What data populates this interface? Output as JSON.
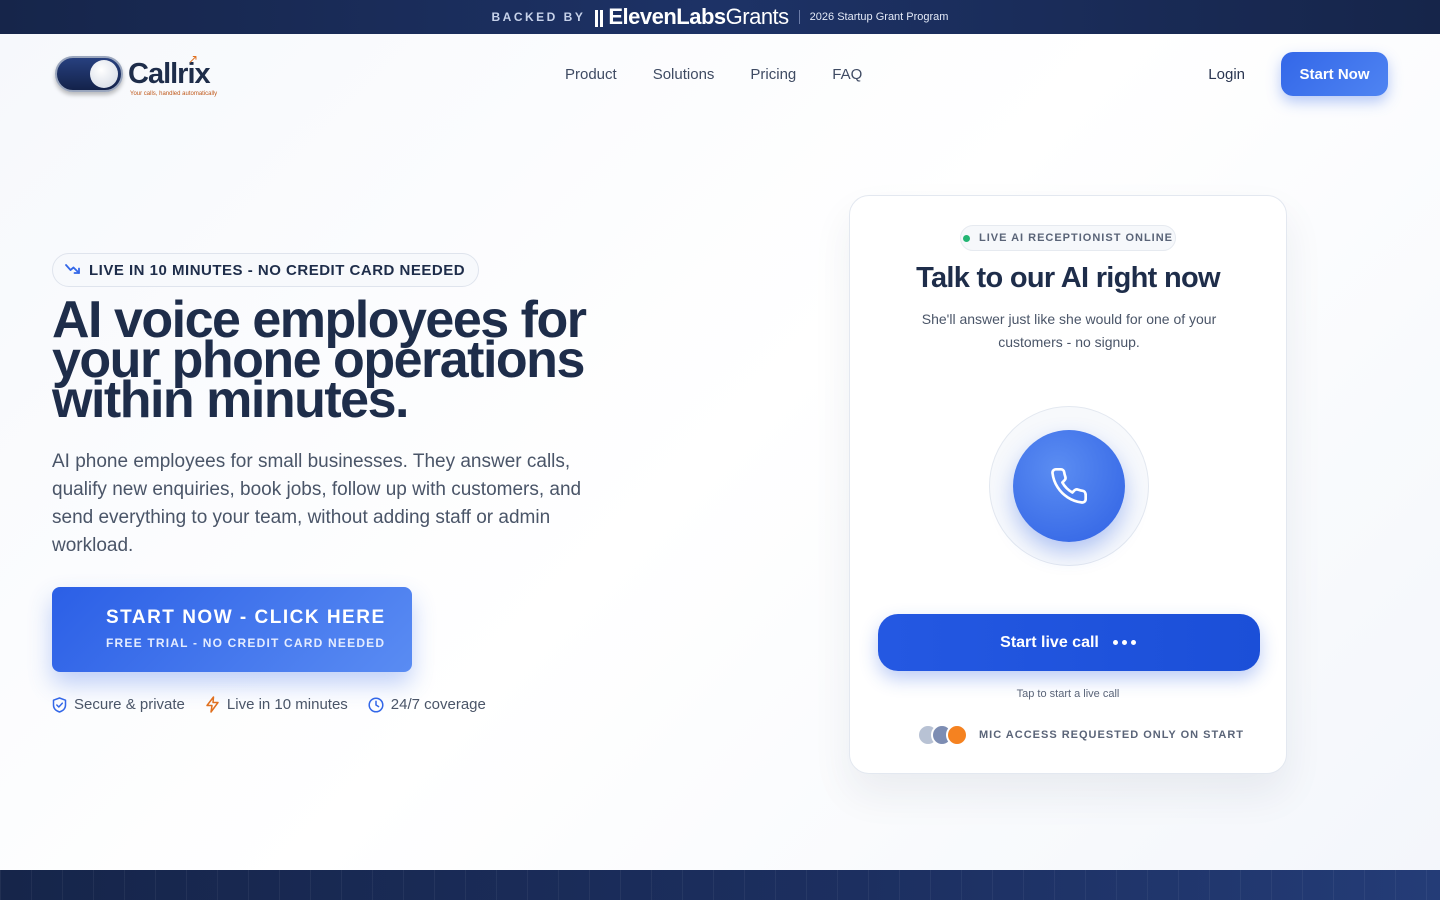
{
  "banner": {
    "backed_by": "BACKED BY",
    "brand_bold": "ElevenLabs",
    "brand_light": "Grants",
    "program": "2026 Startup Grant Program"
  },
  "nav": {
    "logo_name": "Callrix",
    "logo_tagline": "Your calls, handled automatically",
    "links": [
      "Product",
      "Solutions",
      "Pricing",
      "FAQ"
    ],
    "login": "Login",
    "start_now": "Start Now"
  },
  "hero": {
    "pill": "LIVE IN 10 MINUTES - NO CREDIT CARD NEEDED",
    "headline": [
      "AI voice employees for",
      "your phone operations",
      "within minutes."
    ],
    "subtext": "AI phone employees for small businesses. They answer calls, qualify new enquiries, book jobs, follow up with customers, and send everything to your team, without adding staff or admin workload.",
    "cta_main": "START NOW - CLICK HERE",
    "cta_sub": "FREE TRIAL - NO CREDIT CARD NEEDED",
    "trust": [
      "Secure & private",
      "Live in 10 minutes",
      "24/7 coverage"
    ]
  },
  "card": {
    "status": "LIVE AI RECEPTIONIST ONLINE",
    "title": "Talk to our AI right now",
    "subtitle": "She'll answer just like she would for one of your customers - no signup.",
    "call_button": "Start live call",
    "tap_hint": "Tap to start a live call",
    "mic_note": "MIC ACCESS REQUESTED ONLY ON START"
  },
  "colors": {
    "accent": "#3367e8",
    "navy": "#1e2d4a",
    "online": "#22b573",
    "logo_orange": "#e0701f"
  },
  "icons": {
    "pill": "trending-down-icon",
    "trust": [
      "shield-check-icon",
      "lightning-icon",
      "clock-icon"
    ],
    "call": "phone-icon"
  }
}
